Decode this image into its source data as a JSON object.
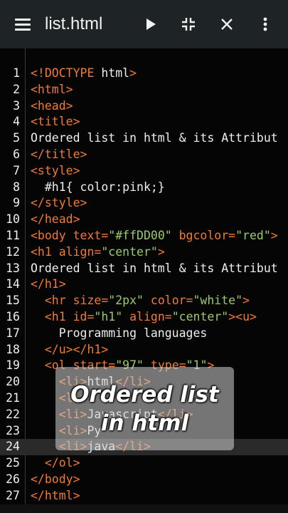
{
  "app_bar": {
    "file_title": "list.html",
    "icons": [
      "menu-icon",
      "play-icon",
      "collapse-icon",
      "close-icon",
      "more-vert-icon"
    ]
  },
  "editor": {
    "active_line": 24,
    "lines": [
      {
        "n": "1",
        "t": [
          {
            "c": "tag",
            "s": "<!DOCTYPE "
          },
          {
            "c": "txt",
            "s": "html"
          },
          {
            "c": "tag",
            "s": ">"
          }
        ]
      },
      {
        "n": "2",
        "t": [
          {
            "c": "tag",
            "s": "<html>"
          }
        ]
      },
      {
        "n": "3",
        "t": [
          {
            "c": "tag",
            "s": "<head>"
          }
        ]
      },
      {
        "n": "4",
        "t": [
          {
            "c": "tag",
            "s": "<title>"
          }
        ]
      },
      {
        "n": "5",
        "t": [
          {
            "c": "txt",
            "s": "Ordered list in html & its Attribut"
          }
        ]
      },
      {
        "n": "6",
        "t": [
          {
            "c": "tag",
            "s": "</title>"
          }
        ]
      },
      {
        "n": "7",
        "t": [
          {
            "c": "tag",
            "s": "<style>"
          }
        ]
      },
      {
        "n": "8",
        "t": [
          {
            "c": "txt",
            "s": "  #h1{ color:pink;}"
          }
        ]
      },
      {
        "n": "9",
        "t": [
          {
            "c": "tag",
            "s": "</style>"
          }
        ]
      },
      {
        "n": "10",
        "t": [
          {
            "c": "tag",
            "s": "</head>"
          }
        ]
      },
      {
        "n": "11",
        "t": [
          {
            "c": "tag",
            "s": "<body "
          },
          {
            "c": "attr",
            "s": "text="
          },
          {
            "c": "str",
            "s": "\"#ffDD00\""
          },
          {
            "c": "attr",
            "s": " bgcolor="
          },
          {
            "c": "str",
            "s": "\"red\""
          },
          {
            "c": "tag",
            "s": ">"
          }
        ]
      },
      {
        "n": "12",
        "t": [
          {
            "c": "tag",
            "s": "<h1 "
          },
          {
            "c": "attr",
            "s": "align="
          },
          {
            "c": "str",
            "s": "\"center\""
          },
          {
            "c": "tag",
            "s": ">"
          }
        ]
      },
      {
        "n": "13",
        "t": [
          {
            "c": "txt",
            "s": "Ordered list in html & its Attribut"
          }
        ]
      },
      {
        "n": "14",
        "t": [
          {
            "c": "tag",
            "s": "</h1>"
          }
        ]
      },
      {
        "n": "15",
        "t": [
          {
            "c": "tag",
            "s": "  <hr "
          },
          {
            "c": "attr",
            "s": "size="
          },
          {
            "c": "str",
            "s": "\"2px\""
          },
          {
            "c": "attr",
            "s": " color="
          },
          {
            "c": "str",
            "s": "\"white\""
          },
          {
            "c": "tag",
            "s": ">"
          }
        ]
      },
      {
        "n": "16",
        "t": [
          {
            "c": "tag",
            "s": "  <h1 "
          },
          {
            "c": "attr",
            "s": "id="
          },
          {
            "c": "str",
            "s": "\"h1\""
          },
          {
            "c": "attr",
            "s": " align="
          },
          {
            "c": "str",
            "s": "\"center\""
          },
          {
            "c": "tag",
            "s": "><u>"
          }
        ]
      },
      {
        "n": "17",
        "t": [
          {
            "c": "txt",
            "s": "    Programming languages"
          }
        ]
      },
      {
        "n": "18",
        "t": [
          {
            "c": "tag",
            "s": "  </u></h1>"
          }
        ]
      },
      {
        "n": "19",
        "t": [
          {
            "c": "tag",
            "s": "  <ol "
          },
          {
            "c": "attr",
            "s": "start="
          },
          {
            "c": "str",
            "s": "\"97\""
          },
          {
            "c": "attr",
            "s": " type="
          },
          {
            "c": "str",
            "s": "\"1\""
          },
          {
            "c": "tag",
            "s": ">"
          }
        ]
      },
      {
        "n": "20",
        "t": [
          {
            "c": "tag",
            "s": "    <li>"
          },
          {
            "c": "txt",
            "s": "html"
          },
          {
            "c": "tag",
            "s": "</li>"
          }
        ]
      },
      {
        "n": "21",
        "t": [
          {
            "c": "tag",
            "s": "    <li>"
          }
        ]
      },
      {
        "n": "22",
        "t": [
          {
            "c": "tag",
            "s": "    <li>"
          },
          {
            "c": "txt",
            "s": "Javascript"
          },
          {
            "c": "tag",
            "s": "</li>"
          }
        ]
      },
      {
        "n": "23",
        "t": [
          {
            "c": "tag",
            "s": "    <li>"
          },
          {
            "c": "txt",
            "s": "Py"
          }
        ]
      },
      {
        "n": "24",
        "t": [
          {
            "c": "tag",
            "s": "    <li>"
          },
          {
            "c": "txt",
            "s": "java"
          },
          {
            "c": "tag",
            "s": "</li>"
          }
        ]
      },
      {
        "n": "25",
        "t": [
          {
            "c": "tag",
            "s": "  </ol>"
          }
        ]
      },
      {
        "n": "26",
        "t": [
          {
            "c": "tag",
            "s": "</body>"
          }
        ]
      },
      {
        "n": "27",
        "t": [
          {
            "c": "tag",
            "s": "</html>"
          }
        ]
      }
    ]
  },
  "overlay": {
    "line1": "Ordered list",
    "line2": "in html"
  },
  "colors": {
    "tag": "#f07a36",
    "string": "#9acb6b",
    "text": "#eeeeee",
    "background": "#050505",
    "app_bar": "#1e2326"
  }
}
